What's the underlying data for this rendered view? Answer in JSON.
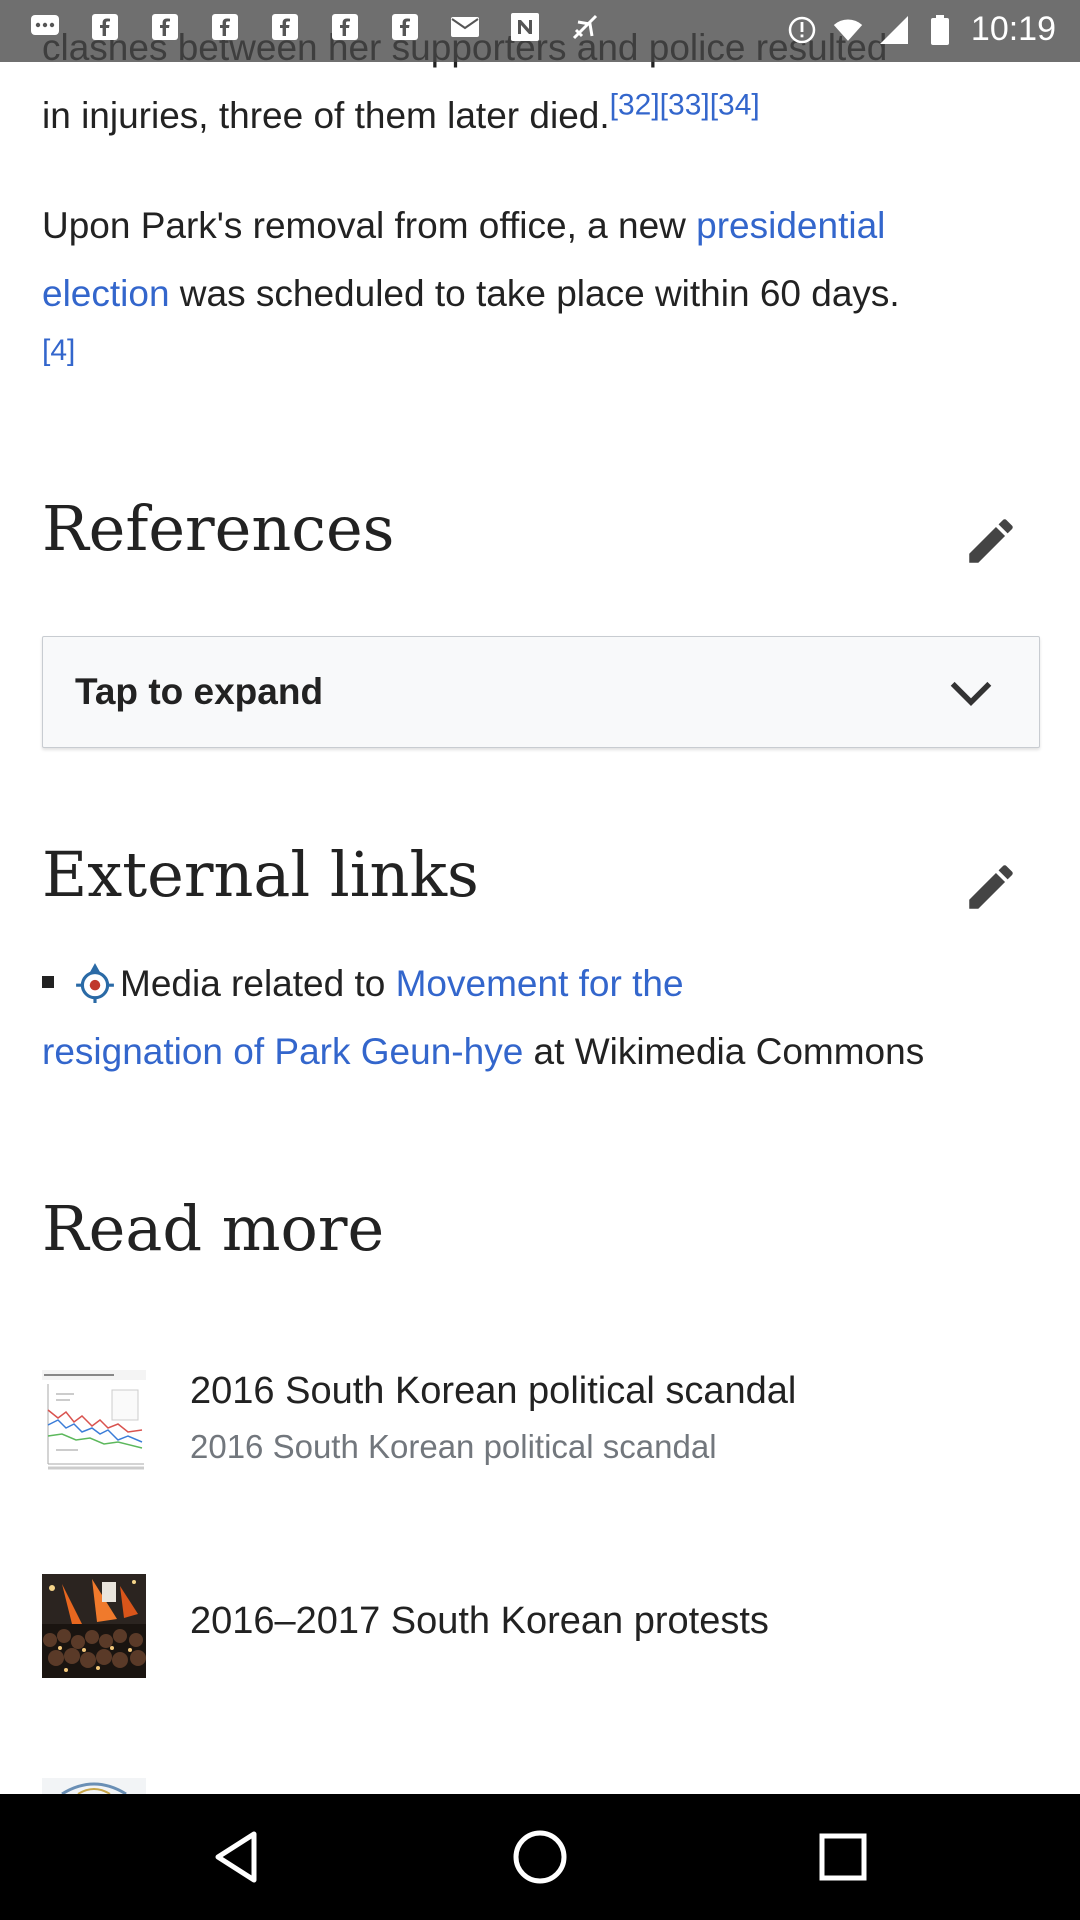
{
  "status_bar": {
    "time": "10:19",
    "icons": [
      "chat-bubble-icon",
      "facebook-icon",
      "facebook-icon",
      "facebook-icon",
      "facebook-icon",
      "facebook-icon",
      "facebook-icon",
      "mail-icon",
      "news-icon",
      "airplane-icon",
      "alert-icon",
      "wifi-icon",
      "signal-icon",
      "battery-icon"
    ]
  },
  "article": {
    "para1_partial": "clashes between her supporters and police resulted",
    "para1_line2": "in injuries, three of them later died.",
    "para1_cites": "[32][33][34]",
    "para2_a": "Upon Park's removal from office, a new ",
    "para2_link": "presidential election",
    "para2_link_line1": "presidential",
    "para2_link_line2": "election",
    "para2_b": " was scheduled to take place within 60 days.",
    "para2_cite": "[4]"
  },
  "references": {
    "heading": "References",
    "expand_label": "Tap to expand"
  },
  "external_links": {
    "heading": "External links",
    "item_prefix": "Media related to ",
    "item_link": "Movement for the resignation of Park Geun-hye",
    "item_link_line1": "Movement for the",
    "item_link_line2": "resignation of Park Geun-hye",
    "item_suffix": " at Wikimedia Commons"
  },
  "read_more": {
    "heading": "Read more",
    "items": [
      {
        "title": "2016 South Korean political scandal",
        "description": "2016 South Korean political scandal"
      },
      {
        "title": "2016–2017 South Korean protests",
        "description": ""
      }
    ]
  },
  "colors": {
    "link": "#3366cc",
    "text": "#222222",
    "secondary_text": "#72777d",
    "expand_bg": "#f8f9fa"
  }
}
